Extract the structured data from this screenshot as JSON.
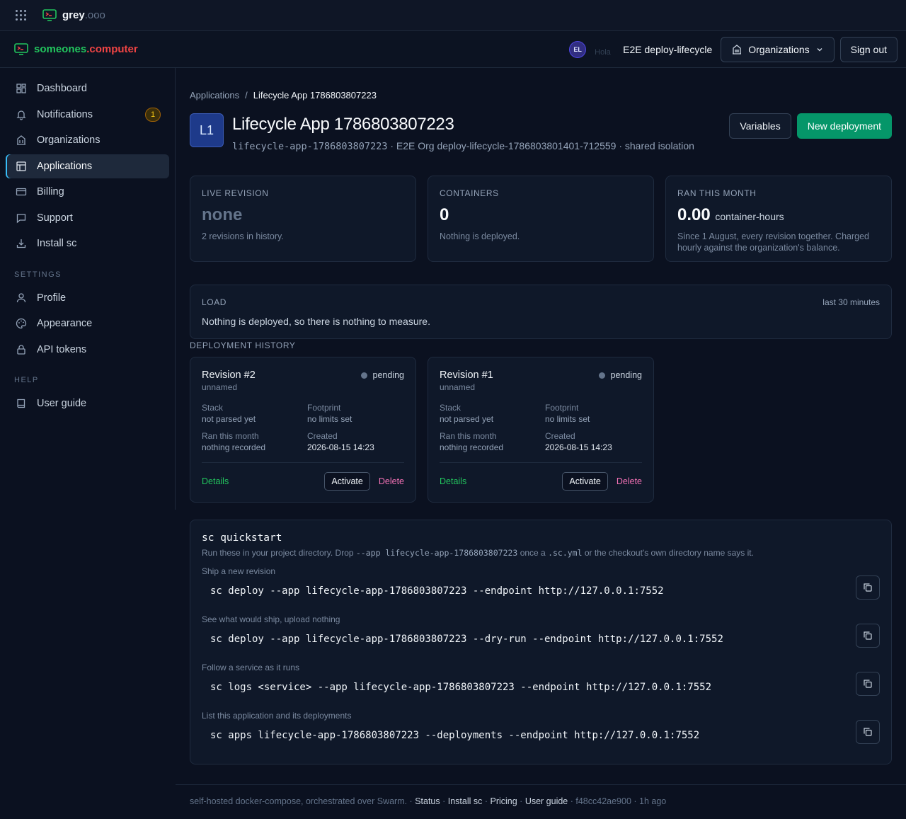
{
  "topbar": {
    "brand": "grey",
    "brand_suffix": ".ooo"
  },
  "header": {
    "brand_left": "someones",
    "brand_dot": ".",
    "brand_right": "computer",
    "avatar_initials": "EL",
    "greeting": "Hola",
    "user_name": "E2E deploy-lifecycle",
    "orgs_button": "Organizations",
    "signout_button": "Sign out"
  },
  "sidebar": {
    "items": [
      {
        "label": "Dashboard"
      },
      {
        "label": "Notifications",
        "badge": "1"
      },
      {
        "label": "Organizations"
      },
      {
        "label": "Applications",
        "active": true
      },
      {
        "label": "Billing"
      },
      {
        "label": "Support"
      },
      {
        "label": "Install sc"
      }
    ],
    "settings_heading": "SETTINGS",
    "settings_items": [
      {
        "label": "Profile"
      },
      {
        "label": "Appearance"
      },
      {
        "label": "API tokens"
      }
    ],
    "help_heading": "HELP",
    "help_items": [
      {
        "label": "User guide"
      }
    ]
  },
  "breadcrumb": {
    "parent": "Applications",
    "sep": "/",
    "current": "Lifecycle App 1786803807223"
  },
  "app": {
    "badge": "L1",
    "title": "Lifecycle App 1786803807223",
    "slug": "lifecycle-app-1786803807223",
    "meta": " · E2E Org deploy-lifecycle-1786803801401-712559 · shared isolation",
    "variables_button": "Variables",
    "new_deployment_button": "New deployment"
  },
  "stats": {
    "live_revision": {
      "label": "LIVE REVISION",
      "value": "none",
      "note": "2 revisions in history."
    },
    "containers": {
      "label": "CONTAINERS",
      "value": "0",
      "note": "Nothing is deployed."
    },
    "ran_this_month": {
      "label": "RAN THIS MONTH",
      "value": "0.00",
      "unit": "container-hours",
      "note": "Since 1 August, every revision together. Charged hourly against the organization's balance."
    }
  },
  "load": {
    "label": "LOAD",
    "range": "last 30 minutes",
    "message": "Nothing is deployed, so there is nothing to measure."
  },
  "history": {
    "label": "DEPLOYMENT HISTORY",
    "revisions": [
      {
        "title": "Revision #2",
        "status": "pending",
        "name": "unnamed",
        "stack_label": "Stack",
        "stack": "not parsed yet",
        "footprint_label": "Footprint",
        "footprint": "no limits set",
        "ran_label": "Ran this month",
        "ran": "nothing recorded",
        "created_label": "Created",
        "created": "2026-08-15 14:23",
        "details": "Details",
        "activate": "Activate",
        "delete": "Delete"
      },
      {
        "title": "Revision #1",
        "status": "pending",
        "name": "unnamed",
        "stack_label": "Stack",
        "stack": "not parsed yet",
        "footprint_label": "Footprint",
        "footprint": "no limits set",
        "ran_label": "Ran this month",
        "ran": "nothing recorded",
        "created_label": "Created",
        "created": "2026-08-15 14:23",
        "details": "Details",
        "activate": "Activate",
        "delete": "Delete"
      }
    ]
  },
  "quickstart": {
    "title": "sc quickstart",
    "desc_pre": "Run these in your project directory. Drop ",
    "desc_code": "--app lifecycle-app-1786803807223",
    "desc_mid": " once a ",
    "desc_code2": ".sc.yml",
    "desc_post": " or the checkout's own directory name says it.",
    "commands": [
      {
        "label": "Ship a new revision",
        "cmd": "sc deploy --app lifecycle-app-1786803807223 --endpoint http://127.0.0.1:7552"
      },
      {
        "label": "See what would ship, upload nothing",
        "cmd": "sc deploy --app lifecycle-app-1786803807223 --dry-run --endpoint http://127.0.0.1:7552"
      },
      {
        "label": "Follow a service as it runs",
        "cmd": "sc logs <service> --app lifecycle-app-1786803807223 --endpoint http://127.0.0.1:7552"
      },
      {
        "label": "List this application and its deployments",
        "cmd": "sc apps lifecycle-app-1786803807223 --deployments --endpoint http://127.0.0.1:7552"
      }
    ]
  },
  "footer": {
    "text": "self-hosted docker-compose, orchestrated over Swarm.",
    "links": [
      "Status",
      "Install sc",
      "Pricing",
      "User guide"
    ],
    "commit": "f48cc42ae900",
    "age": "1h ago"
  },
  "colors": {
    "accent_green": "#059669",
    "brand_red": "#ef4444",
    "brand_green": "#22c55e",
    "delete_pink": "#f472b6"
  }
}
